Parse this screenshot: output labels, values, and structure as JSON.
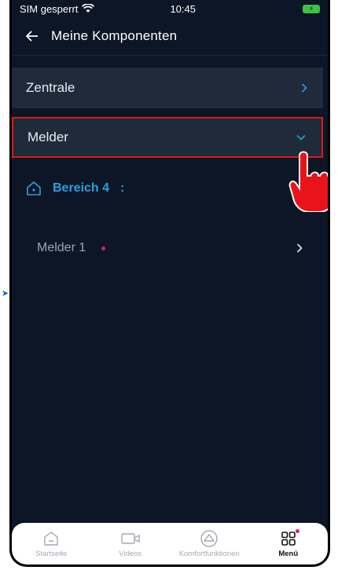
{
  "status": {
    "carrier": "SIM gesperrt",
    "time": "10:45"
  },
  "header": {
    "title": "Meine Komponenten"
  },
  "rows": {
    "zentrale": "Zentrale",
    "melder": "Melder"
  },
  "area": {
    "label": "Bereich 4",
    "suffix": ":"
  },
  "items": [
    {
      "label": "Melder 1"
    }
  ],
  "tabs": [
    {
      "label": "Startseite"
    },
    {
      "label": "Videos"
    },
    {
      "label": "Komfortfunktionen"
    },
    {
      "label": "Menü"
    }
  ],
  "colors": {
    "bg": "#0d1626",
    "row": "#1f2a3a",
    "accent": "#2b9fe0",
    "highlight": "#e01818",
    "dot": "#e0186f"
  }
}
